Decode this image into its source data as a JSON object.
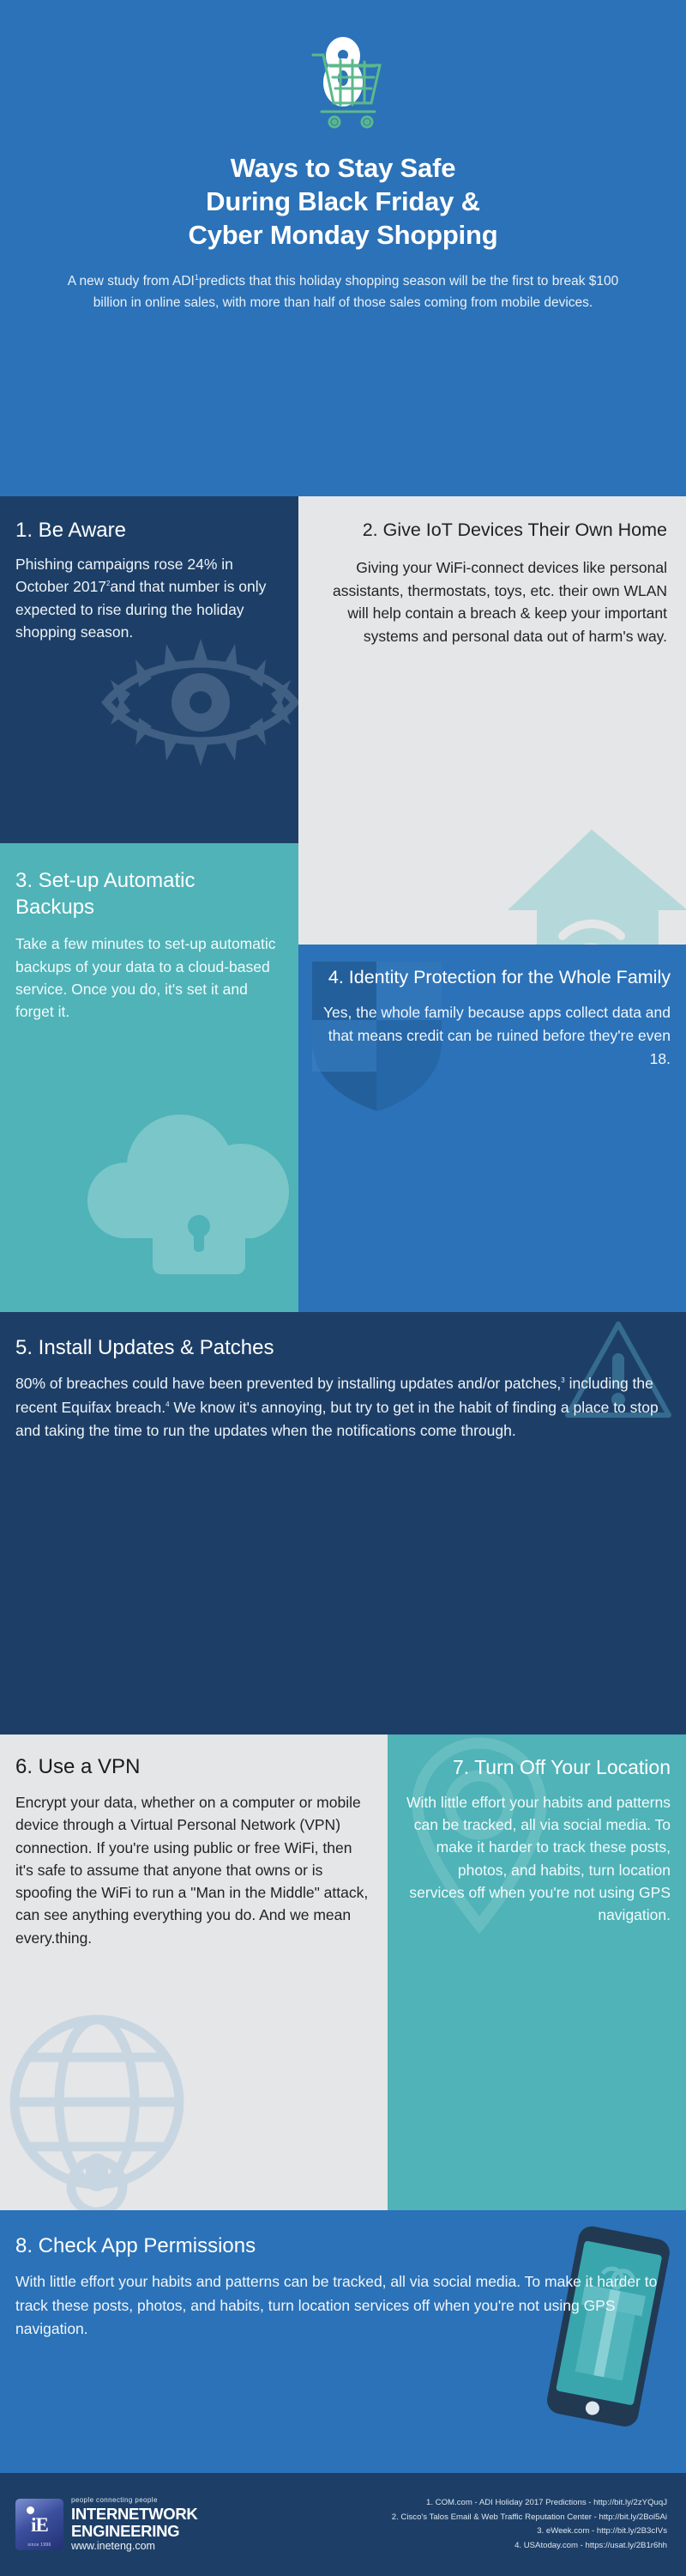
{
  "header": {
    "icon": "shopping-cart-lock-icon",
    "title_lines": [
      "Ways to Stay Safe",
      "During Black Friday &",
      "Cyber Monday Shopping"
    ],
    "subtitle_pre": "A new study from ADI",
    "subtitle_ref": "1",
    "subtitle_post": "predicts that this holiday shopping season will be the first to break $100 billion in online sales, with more than half of those sales coming from mobile devices."
  },
  "sections": [
    {
      "number": "1.",
      "title": "1. Be Aware",
      "body_pre": "Phishing campaigns rose 24% in October 2017",
      "body_ref": "2",
      "body_post": "and that number is only expected to rise during the holiday shopping season.",
      "bg_icon": "eye-icon",
      "bg_color": "#1d3f67",
      "text_color": "#ffffff"
    },
    {
      "number": "2.",
      "title": "2.  Give IoT Devices Their Own Home",
      "body": "Giving your WiFi-connect devices like personal assistants, thermostats, toys, etc. their own WLAN will help contain a breach & keep your important systems and personal data out of harm's way.",
      "bg_icon": "house-wifi-icon",
      "bg_color": "#e5e6e8",
      "text_color": "#232323"
    },
    {
      "number": "3.",
      "title": "3. Set-up Automatic Backups",
      "body": "Take a few minutes to set-up automatic backups of your data to a cloud-based service. Once you do, it's set it and forget it.",
      "bg_icon": "cloud-lock-icon",
      "bg_color": "#4fb3b8",
      "text_color": "#ffffff"
    },
    {
      "number": "4.",
      "title": "4. Identity Protection for the Whole Family",
      "body": "Yes, the whole family because apps collect data and that means credit can be ruined before they're even 18.",
      "bg_icon": "shield-icon",
      "bg_color": "#2b72b8",
      "text_color": "#ffffff"
    },
    {
      "number": "5.",
      "title": "5. Install Updates & Patches",
      "body_pre": "80% of breaches could have been prevented by installing updates and/or patches,",
      "body_ref1": "3",
      "body_mid": " including the recent Equifax breach.",
      "body_ref2": "4",
      "body_post": " We know it's annoying, but try to get in the habit of finding a place to stop and taking the time to run the updates when the notifications come through.",
      "bg_icon": "warning-triangle-icon",
      "bg_color": "#1d3f67",
      "text_color": "#ffffff"
    },
    {
      "number": "6.",
      "title": "6. Use a VPN",
      "body": "Encrypt your data, whether on a computer or mobile device through a Virtual Personal Network (VPN) connection. If you're using public or free WiFi, then it's safe to assume that anyone that owns or is spoofing the WiFi to run a \"Man in the Middle\" attack, can see anything everything you do. And we mean every.thing.",
      "bg_icon": "globe-icon",
      "bg_color": "#e5e6e8",
      "text_color": "#232323"
    },
    {
      "number": "7.",
      "title": "7. Turn Off Your Location",
      "body": "With little effort your habits and patterns can be tracked, all via social media. To make it harder to track these posts, photos, and habits, turn location services off when you're not using GPS navigation.",
      "bg_icon": "map-pin-icon",
      "bg_color": "#4fb3b8",
      "text_color": "#ffffff"
    },
    {
      "number": "8.",
      "title": "8. Check App Permissions",
      "body": "With little effort your habits and patterns can be tracked, all via social media. To make it harder to track these posts, photos, and habits, turn location services off when you're not using GPS navigation.",
      "bg_icon": "smartphone-gift-icon",
      "bg_color": "#2b72b8",
      "text_color": "#ffffff"
    }
  ],
  "footer": {
    "logo": {
      "mark_text": "iE",
      "since": "since 1996",
      "tagline": "people connecting people",
      "name_line1": "INTERNETWORK",
      "name_line2": "ENGINEERING",
      "url": "www.ineteng.com"
    },
    "references": [
      "1. COM.com - ADI Holiday 2017 Predictions - http://bit.ly/2zYQuqJ",
      "2. Cisco's Talos Email & Web Traffic Reputation Center - http://bit.ly/2Bol5Ai",
      "3. eWeek.com - http://bit.ly/2B3cIVs",
      "4. USAtoday.com - https://usat.ly/2B1r6hh"
    ]
  },
  "colors": {
    "brand_blue": "#2b72b8",
    "navy": "#1d3f67",
    "teal": "#4fb3b8",
    "light_gray": "#e5e6e8"
  }
}
